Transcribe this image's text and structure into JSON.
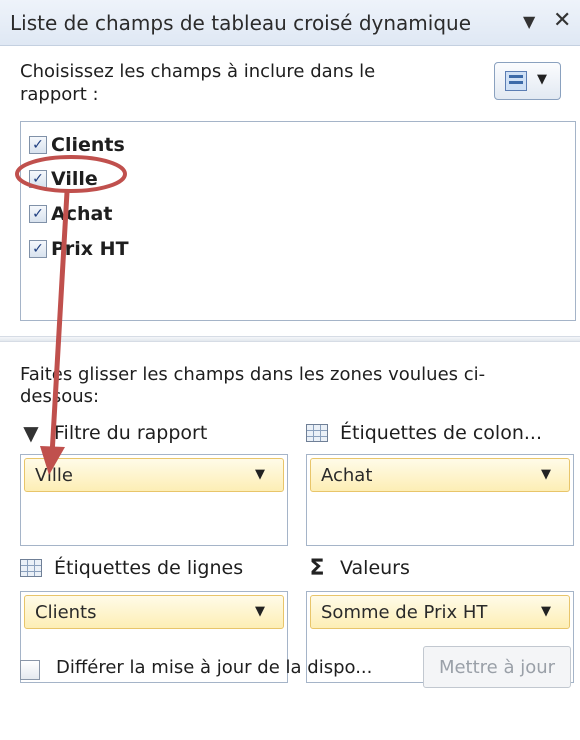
{
  "panel": {
    "title": "Liste de champs de tableau croisé dynamique",
    "dropdown_icon": "chevron-down-icon",
    "close_icon": "close-icon"
  },
  "chooser": {
    "instruction": "Choisissez les champs à inclure dans le rapport :",
    "layout_button_icon": "field-list-layout-icon"
  },
  "fields": [
    {
      "label": "Clients",
      "checked": true
    },
    {
      "label": "Ville",
      "checked": true
    },
    {
      "label": "Achat",
      "checked": true
    },
    {
      "label": "Prix HT",
      "checked": true
    }
  ],
  "areas": {
    "hint": "Faites glisser les champs dans les zones voulues ci-dessous:",
    "report_filter": {
      "label": "Filtre du rapport",
      "icon": "filter-icon",
      "item": "Ville"
    },
    "column_labels": {
      "label": "Étiquettes de colon...",
      "icon": "grid-icon",
      "item": "Achat"
    },
    "row_labels": {
      "label": "Étiquettes de lignes",
      "icon": "grid-icon",
      "item": "Clients"
    },
    "values": {
      "label": "Valeurs",
      "icon": "sigma-icon",
      "item": "Somme de Prix HT"
    }
  },
  "footer": {
    "defer_label": "Différer la mise à jour de la dispo...",
    "defer_checked": false,
    "update_button": "Mettre à jour"
  },
  "colors": {
    "annotation": "#c0504d",
    "chip_border": "#e8c56a",
    "chip_fill": "#fdeeb5"
  }
}
